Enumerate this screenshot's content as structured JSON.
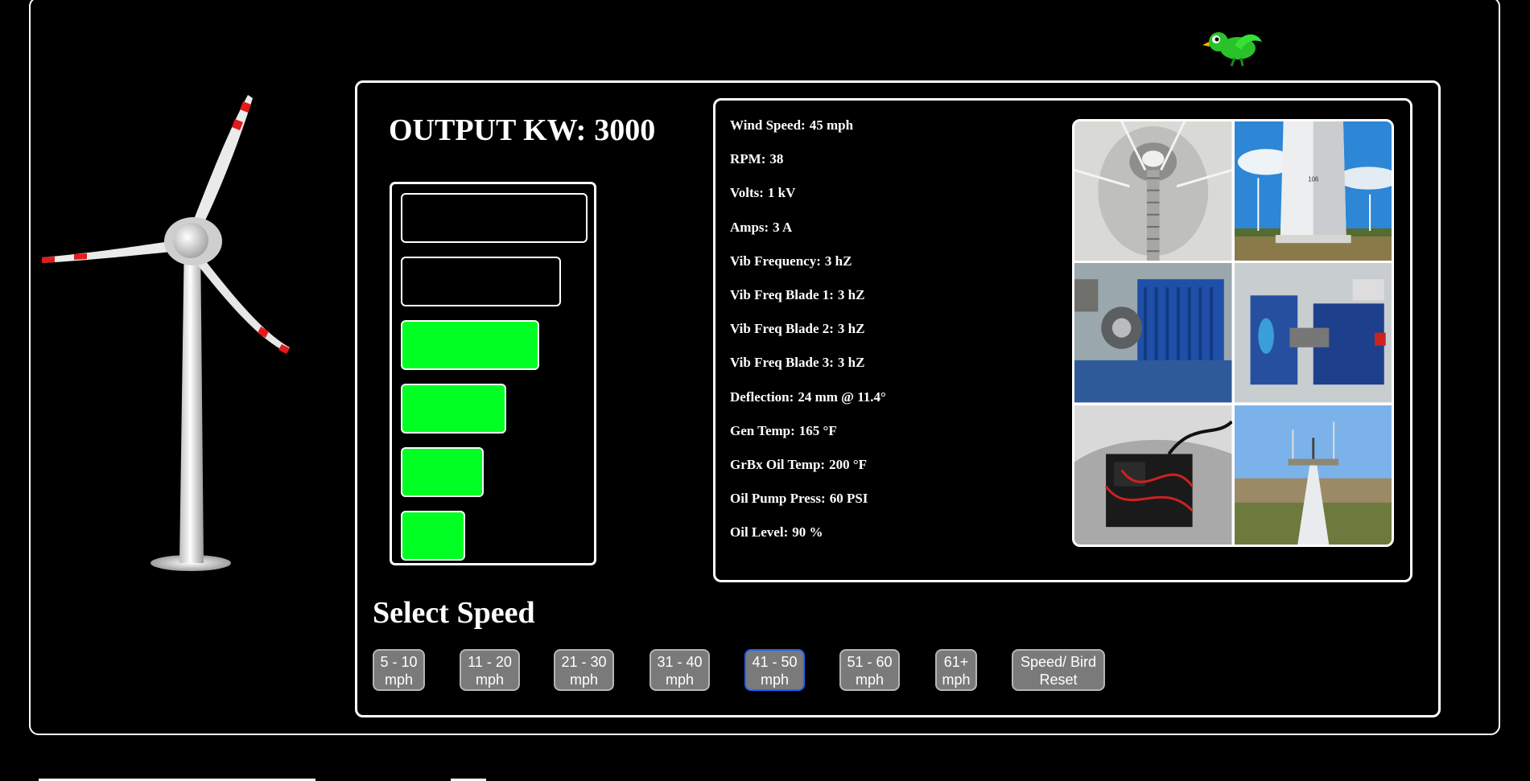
{
  "output": {
    "label": "OUTPUT KW:",
    "value": "3000"
  },
  "meter": {
    "bars": [
      {
        "level": 0.88,
        "on": false
      },
      {
        "level": 0.74,
        "on": false
      },
      {
        "level": 0.62,
        "on": true
      },
      {
        "level": 0.44,
        "on": true
      },
      {
        "level": 0.32,
        "on": true
      },
      {
        "level": 0.22,
        "on": true
      }
    ],
    "on_color": "#00ff22"
  },
  "readings": [
    {
      "label": "Wind Speed:",
      "value": "45 mph"
    },
    {
      "label": "RPM:",
      "value": "38"
    },
    {
      "label": "Volts:",
      "value": "1 kV"
    },
    {
      "label": "Amps:",
      "value": "3 A"
    },
    {
      "label": "Vib Frequency:",
      "value": "3 hZ"
    },
    {
      "label": "Vib Freq Blade 1:",
      "value": "3 hZ"
    },
    {
      "label": "Vib Freq Blade 2:",
      "value": "3 hZ"
    },
    {
      "label": "Vib Freq Blade 3:",
      "value": "3 hZ"
    },
    {
      "label": "Deflection:",
      "value": "24 mm @ 11.4°"
    },
    {
      "label": "Gen Temp:",
      "value": "165 °F"
    },
    {
      "label": "GrBx Oil Temp:",
      "value": "200 °F"
    },
    {
      "label": "Oil Pump Press:",
      "value": "60 PSI"
    },
    {
      "label": "Oil Level:",
      "value": "90 %"
    }
  ],
  "photos": [
    {
      "name": "tower-interior-photo"
    },
    {
      "name": "tower-base-photo",
      "tower_number": "106"
    },
    {
      "name": "generator-photo"
    },
    {
      "name": "nacelle-machinery-photo"
    },
    {
      "name": "control-box-photo"
    },
    {
      "name": "nacelle-top-view-photo"
    }
  ],
  "speed_select": {
    "title": "Select Speed",
    "buttons": [
      {
        "line1": "5 - 10",
        "line2": "mph",
        "active": false
      },
      {
        "line1": "11 - 20",
        "line2": "mph",
        "active": false
      },
      {
        "line1": "21 - 30",
        "line2": "mph",
        "active": false
      },
      {
        "line1": "31 - 40",
        "line2": "mph",
        "active": false
      },
      {
        "line1": "41 - 50",
        "line2": "mph",
        "active": true
      },
      {
        "line1": "51 - 60",
        "line2": "mph",
        "active": false
      },
      {
        "line1": "61+",
        "line2": "mph",
        "active": false
      },
      {
        "line1": "Speed/ Bird",
        "line2": "Reset",
        "active": false
      }
    ],
    "active_border_color": "#1e63ff"
  },
  "icons": {
    "turbine": "wind-turbine-icon",
    "bird": "bird-icon"
  }
}
